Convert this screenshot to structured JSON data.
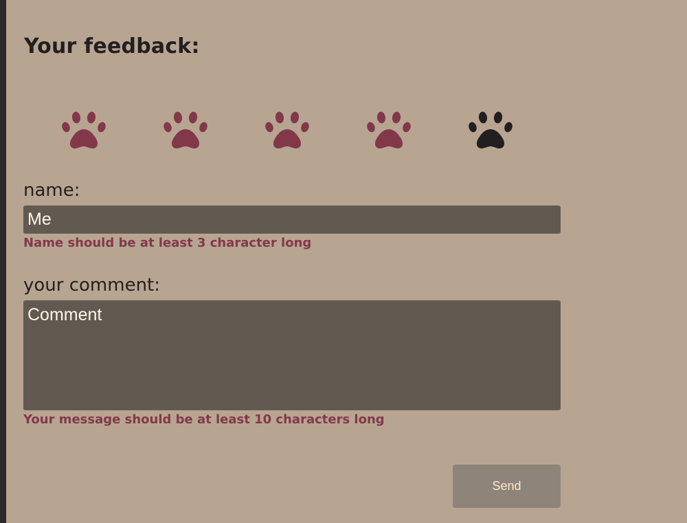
{
  "form": {
    "heading": "Your feedback:",
    "rating": {
      "value": 4,
      "max": 5,
      "icon": "paw-icon",
      "active_color": "#83384a",
      "inactive_color": "#231f20"
    },
    "name": {
      "label": "name:",
      "value": "Me",
      "error": "Name should be at least 3 character long"
    },
    "comment": {
      "label": "your comment:",
      "placeholder": "Comment",
      "value": "",
      "error": "Your message should be at least 10 characters long"
    },
    "send_label": "Send"
  },
  "colors": {
    "background": "#b7a591",
    "input_background": "#625a51",
    "error": "#83384a",
    "button_background": "#8f847a",
    "button_text": "#fbe7cf"
  }
}
